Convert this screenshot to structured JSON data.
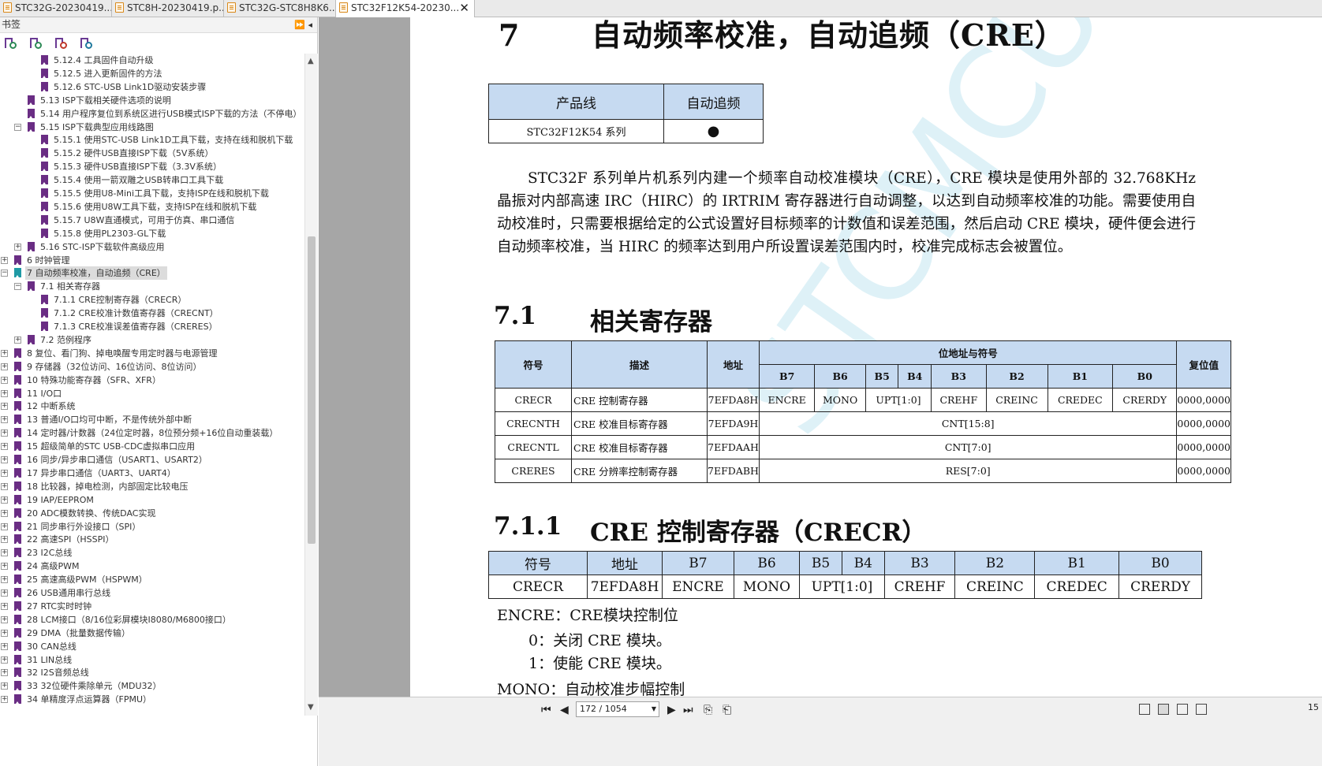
{
  "tabs": [
    {
      "label": "STC32G-20230419...",
      "active": false
    },
    {
      "label": "STC8H-20230419.p...",
      "active": false
    },
    {
      "label": "STC32G-STC8H8K6...",
      "active": false
    },
    {
      "label": "STC32F12K54-20230...",
      "active": true
    }
  ],
  "sidebar": {
    "title": "书签",
    "toggle": "⏩ ◂",
    "items": [
      {
        "label": "5.12.4 工具固件自动升级",
        "level": 3,
        "exp": ""
      },
      {
        "label": "5.12.5 进入更新固件的方法",
        "level": 3,
        "exp": ""
      },
      {
        "label": "5.12.6 STC-USB Link1D驱动安装步骤",
        "level": 3,
        "exp": ""
      },
      {
        "label": "5.13 ISP下载相关硬件选项的说明",
        "level": 2,
        "exp": ""
      },
      {
        "label": "5.14 用户程序复位到系统区进行USB模式ISP下载的方法（不停电）",
        "level": 2,
        "exp": ""
      },
      {
        "label": "5.15 ISP下载典型应用线路图",
        "level": 2,
        "exp": "−"
      },
      {
        "label": "5.15.1 使用STC-USB Link1D工具下载，支持在线和脱机下载",
        "level": 3,
        "exp": ""
      },
      {
        "label": "5.15.2 硬件USB直接ISP下载（5V系统）",
        "level": 3,
        "exp": ""
      },
      {
        "label": "5.15.3 硬件USB直接ISP下载（3.3V系统）",
        "level": 3,
        "exp": ""
      },
      {
        "label": "5.15.4 使用一箭双雕之USB转串口工具下载",
        "level": 3,
        "exp": ""
      },
      {
        "label": "5.15.5 使用U8-Mini工具下载，支持ISP在线和脱机下载",
        "level": 3,
        "exp": ""
      },
      {
        "label": "5.15.6 使用U8W工具下载，支持ISP在线和脱机下载",
        "level": 3,
        "exp": ""
      },
      {
        "label": "5.15.7 U8W直通模式，可用于仿真、串口通信",
        "level": 3,
        "exp": ""
      },
      {
        "label": "5.15.8 使用PL2303-GL下载",
        "level": 3,
        "exp": ""
      },
      {
        "label": "5.16 STC-ISP下载软件高级应用",
        "level": 2,
        "exp": "+"
      },
      {
        "label": "6 时钟管理",
        "level": 1,
        "exp": "+"
      },
      {
        "label": "7 自动频率校准，自动追频（CRE）",
        "level": 1,
        "exp": "−",
        "selected": true
      },
      {
        "label": "7.1 相关寄存器",
        "level": 2,
        "exp": "−"
      },
      {
        "label": "7.1.1 CRE控制寄存器（CRECR）",
        "level": 3,
        "exp": ""
      },
      {
        "label": "7.1.2 CRE校准计数值寄存器（CRECNT）",
        "level": 3,
        "exp": ""
      },
      {
        "label": "7.1.3 CRE校准误差值寄存器（CRERES）",
        "level": 3,
        "exp": ""
      },
      {
        "label": "7.2 范例程序",
        "level": 2,
        "exp": "+"
      },
      {
        "label": "8 复位、看门狗、掉电唤醒专用定时器与电源管理",
        "level": 1,
        "exp": "+"
      },
      {
        "label": "9 存储器（32位访问、16位访问、8位访问）",
        "level": 1,
        "exp": "+"
      },
      {
        "label": "10 特殊功能寄存器（SFR、XFR）",
        "level": 1,
        "exp": "+"
      },
      {
        "label": "11 I/O口",
        "level": 1,
        "exp": "+"
      },
      {
        "label": "12 中断系统",
        "level": 1,
        "exp": "+"
      },
      {
        "label": "13 普通I/O口均可中断，不是传统外部中断",
        "level": 1,
        "exp": "+"
      },
      {
        "label": "14 定时器/计数器（24位定时器，8位预分频+16位自动重装载）",
        "level": 1,
        "exp": "+"
      },
      {
        "label": "15 超级简单的STC USB-CDC虚拟串口应用",
        "level": 1,
        "exp": "+"
      },
      {
        "label": "16 同步/异步串口通信（USART1、USART2）",
        "level": 1,
        "exp": "+"
      },
      {
        "label": "17 异步串口通信（UART3、UART4）",
        "level": 1,
        "exp": "+"
      },
      {
        "label": "18 比较器，掉电检测，内部固定比较电压",
        "level": 1,
        "exp": "+"
      },
      {
        "label": "19 IAP/EEPROM",
        "level": 1,
        "exp": "+"
      },
      {
        "label": "20 ADC模数转换、传统DAC实现",
        "level": 1,
        "exp": "+"
      },
      {
        "label": "21 同步串行外设接口（SPI）",
        "level": 1,
        "exp": "+"
      },
      {
        "label": "22 高速SPI（HSSPI）",
        "level": 1,
        "exp": "+"
      },
      {
        "label": "23 I2C总线",
        "level": 1,
        "exp": "+"
      },
      {
        "label": "24 高级PWM",
        "level": 1,
        "exp": "+"
      },
      {
        "label": "25 高速高级PWM（HSPWM）",
        "level": 1,
        "exp": "+"
      },
      {
        "label": "26 USB通用串行总线",
        "level": 1,
        "exp": "+"
      },
      {
        "label": "27 RTC实时时钟",
        "level": 1,
        "exp": "+"
      },
      {
        "label": "28 LCM接口（8/16位彩屏模块I8080/M6800接口）",
        "level": 1,
        "exp": "+"
      },
      {
        "label": "29 DMA（批量数据传输）",
        "level": 1,
        "exp": "+"
      },
      {
        "label": "30 CAN总线",
        "level": 1,
        "exp": "+"
      },
      {
        "label": "31 LIN总线",
        "level": 1,
        "exp": "+"
      },
      {
        "label": "32 I2S音频总线",
        "level": 1,
        "exp": "+"
      },
      {
        "label": "33 32位硬件乘除单元（MDU32）",
        "level": 1,
        "exp": "+"
      },
      {
        "label": "34 单精度浮点运算器（FPMU）",
        "level": 1,
        "exp": "+"
      }
    ]
  },
  "doc": {
    "chapter_num": "7",
    "chapter_title": "自动频率校准，自动追频（CRE）",
    "product_table": {
      "headers": [
        "产品线",
        "自动追频"
      ],
      "row": [
        "STC32F12K54 系列",
        "●"
      ]
    },
    "paragraph": "STC32F 系列单片机系列内建一个频率自动校准模块（CRE），CRE 模块是使用外部的 32.768KHz 晶振对内部高速 IRC（HIRC）的 IRTRIM 寄存器进行自动调整，以达到自动频率校准的功能。需要使用自动校准时，只需要根据给定的公式设置好目标频率的计数值和误差范围，然后启动 CRE 模块，硬件便会进行自动频率校准，当 HIRC 的频率达到用户所设置误差范围内时，校准完成标志会被置位。",
    "sec71_num": "7.1",
    "sec71_title": "相关寄存器",
    "reg_table": {
      "h_symbol": "符号",
      "h_desc": "描述",
      "h_addr": "地址",
      "h_bits": "位地址与符号",
      "h_reset": "复位值",
      "bits": [
        "B7",
        "B6",
        "B5",
        "B4",
        "B3",
        "B2",
        "B1",
        "B0"
      ],
      "r1": {
        "sym": "CRECR",
        "desc": "CRE 控制寄存器",
        "addr": "7EFDA8H",
        "b7": "ENCRE",
        "b6": "MONO",
        "b54": "UPT[1:0]",
        "b3": "CREHF",
        "b2": "CREINC",
        "b1": "CREDEC",
        "b0": "CRERDY",
        "reset": "0000,0000"
      },
      "r2": {
        "sym": "CRECNTH",
        "desc": "CRE 校准目标寄存器",
        "addr": "7EFDA9H",
        "bits": "CNT[15:8]",
        "reset": "0000,0000"
      },
      "r3": {
        "sym": "CRECNTL",
        "desc": "CRE 校准目标寄存器",
        "addr": "7EFDAAH",
        "bits": "CNT[7:0]",
        "reset": "0000,0000"
      },
      "r4": {
        "sym": "CRERES",
        "desc": "CRE 分辨率控制寄存器",
        "addr": "7EFDABH",
        "bits": "RES[7:0]",
        "reset": "0000,0000"
      }
    },
    "sec711_num": "7.1.1",
    "sec711_title": "CRE 控制寄存器（CRECR）",
    "crecr_table": {
      "headers": [
        "符号",
        "地址",
        "B7",
        "B6",
        "B5",
        "B4",
        "B3",
        "B2",
        "B1",
        "B0"
      ],
      "row": {
        "sym": "CRECR",
        "addr": "7EFDA8H",
        "b7": "ENCRE",
        "b6": "MONO",
        "b54": "UPT[1:0]",
        "b3": "CREHF",
        "b2": "CREINC",
        "b1": "CREDEC",
        "b0": "CRERDY"
      }
    },
    "encre_title": "ENCRE：CRE模块控制位",
    "encre_0": "0：关闭 CRE 模块。",
    "encre_1": "1：使能 CRE 模块。",
    "mono_title": "MONO：自动校准步幅控制",
    "watermark": "STCMCU"
  },
  "navbar": {
    "page_display": "172 / 1054",
    "zoom_text": "15"
  },
  "colors": {
    "table_header": "#c6daf1",
    "bookmark": "#6a2d84",
    "selected_bookmark": "#1f9aa5",
    "gray_area": "#a6a6a6"
  }
}
